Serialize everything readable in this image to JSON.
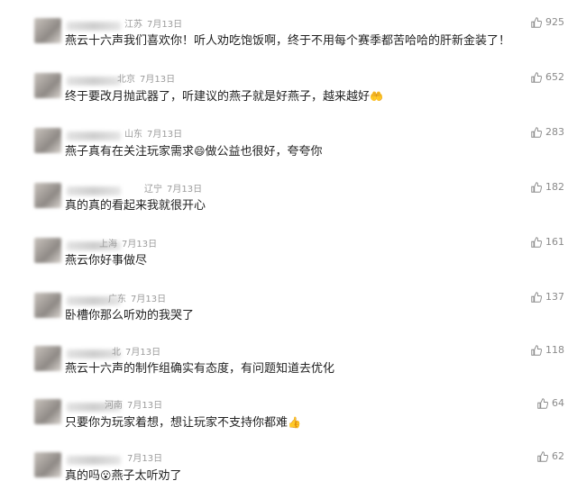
{
  "comments": [
    {
      "location": "江苏",
      "date": "7月13日",
      "text": "燕云十六声我们喜欢你！听人劝吃饱饭啊，终于不用每个赛季都苦哈哈的肝新金装了！",
      "emoji": "",
      "likes": "925"
    },
    {
      "location": "北京",
      "date": "7月13日",
      "text": "终于要改月抛武器了，听建议的燕子就是好燕子，越来越好",
      "emoji": "🤲",
      "likes": "652"
    },
    {
      "location": "山东",
      "date": "7月13日",
      "text": "燕子真有在关注玩家需求",
      "emoji": "😄",
      "text2": "做公益也很好，夸夸你",
      "likes": "283"
    },
    {
      "location": "辽宁",
      "date": "7月13日",
      "text": "真的真的看起来我就很开心",
      "emoji": "",
      "likes": "182"
    },
    {
      "location": "上海",
      "date": "7月13日",
      "text": "燕云你好事做尽",
      "emoji": "",
      "likes": "161"
    },
    {
      "location": "广东",
      "date": "7月13日",
      "text": "卧槽你那么听劝的我哭了",
      "emoji": "",
      "likes": "137"
    },
    {
      "location": "北",
      "date": "7月13日",
      "text": "燕云十六声的制作组确实有态度，有问题知道去优化",
      "emoji": "",
      "likes": "118"
    },
    {
      "location": "河南",
      "date": "7月13日",
      "text": "只要你为玩家着想，想让玩家不支持你都难",
      "emoji": "👍",
      "likes": "64"
    },
    {
      "location": "",
      "date": "7月13日",
      "text": "真的吗",
      "emoji": "😮",
      "text2": "燕子太听劝了",
      "likes": "62"
    }
  ]
}
